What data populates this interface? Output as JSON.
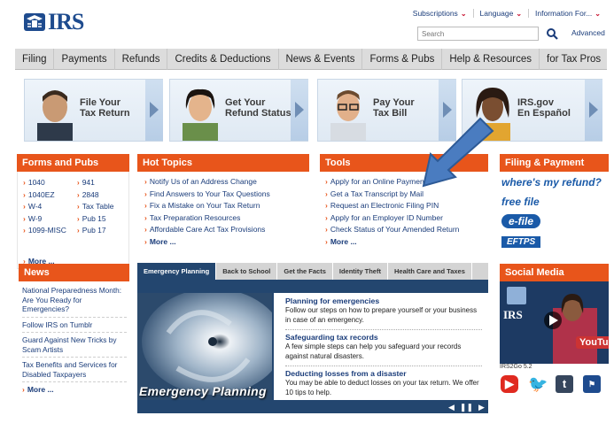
{
  "header": {
    "logo_text": "IRS",
    "toplinks": [
      "Subscriptions",
      "Language",
      "Information For..."
    ],
    "search_placeholder": "Search",
    "advanced_label": "Advanced"
  },
  "nav": [
    "Filing",
    "Payments",
    "Refunds",
    "Credits & Deductions",
    "News & Events",
    "Forms & Pubs",
    "Help & Resources",
    "for Tax Pros"
  ],
  "promos": [
    {
      "line1": "File Your",
      "line2": "Tax Return"
    },
    {
      "line1": "Get Your",
      "line2": "Refund Status"
    },
    {
      "line1": "Pay Your",
      "line2": "Tax Bill"
    },
    {
      "line1": "IRS.gov",
      "line2": "En Español"
    }
  ],
  "forms": {
    "title": "Forms and Pubs",
    "col1": [
      "1040",
      "1040EZ",
      "W-4",
      "W-9",
      "1099-MISC"
    ],
    "col2": [
      "941",
      "2848",
      "Tax Table",
      "Pub 15",
      "Pub 17"
    ],
    "more": "More ..."
  },
  "hot": {
    "title": "Hot Topics",
    "items": [
      "Notify Us of an Address Change",
      "Find Answers to Your Tax Questions",
      "Fix a Mistake on Your Tax Return",
      "Tax Preparation Resources",
      "Affordable Care Act Tax Provisions"
    ],
    "more": "More ..."
  },
  "tools": {
    "title": "Tools",
    "items": [
      "Apply for an Online Payment",
      "Get a Tax Transcript by Mail",
      "Request an Electronic Filing PIN",
      "Apply for an Employer ID Number",
      "Check Status of Your Amended Return"
    ],
    "more": "More ..."
  },
  "filing": {
    "title": "Filing & Payment",
    "logos": [
      "where's my refund?",
      "free file",
      "e-file",
      "EFTPS"
    ]
  },
  "news": {
    "title": "News",
    "items": [
      "National Preparedness Month: Are You Ready for Emergencies?",
      "Follow IRS on Tumblr",
      "Guard Against New Tricks by Scam Artists",
      "Tax Benefits and Services for Disabled Taxpayers"
    ],
    "more": "More ..."
  },
  "tabs": [
    "Emergency Planning",
    "Back to School",
    "Get the Facts",
    "Identity Theft",
    "Health Care and Taxes"
  ],
  "feature": {
    "caption": "Emergency Planning",
    "items": [
      {
        "title": "Planning for emergencies",
        "desc": "Follow our steps on how to prepare yourself or your business in case of an emergency."
      },
      {
        "title": "Safeguarding tax records",
        "desc": "A few simple steps can help you safeguard your records against natural disasters."
      },
      {
        "title": "Deducting losses from a disaster",
        "desc": "You may be able to deduct losses on your tax return. We offer 10 tips to help."
      }
    ]
  },
  "social": {
    "title": "Social Media",
    "video_caption": "IRS2Go 5.2",
    "video_brand": "IRS"
  },
  "colors": {
    "accent": "#e8551b",
    "nav": "#dcdcdc",
    "navy": "#23466f",
    "link": "#1a3c7a"
  }
}
